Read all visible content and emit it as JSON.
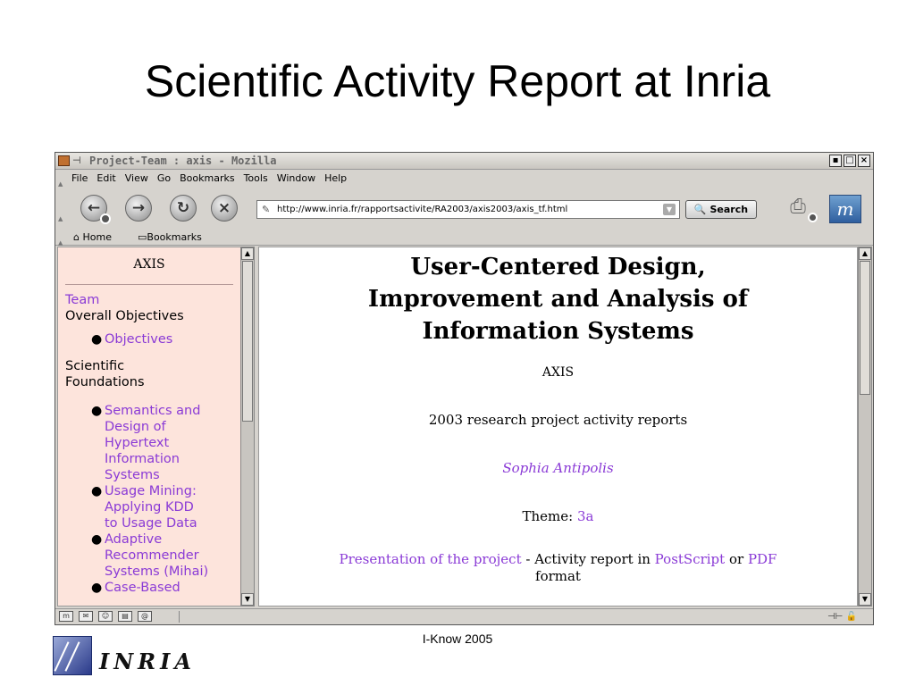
{
  "slide": {
    "title": "Scientific Activity Report at Inria",
    "footer": "I-Know 2005"
  },
  "window": {
    "title": "Project-Team : axis - Mozilla",
    "controls": [
      "▪",
      "□",
      "×"
    ]
  },
  "menubar": {
    "items": [
      "File",
      "Edit",
      "View",
      "Go",
      "Bookmarks",
      "Tools",
      "Window",
      "Help"
    ]
  },
  "navbar": {
    "url": "http://www.inria.fr/rapportsactivite/RA2003/axis2003/axis_tf.html",
    "search_label": "Search"
  },
  "bookmarks": {
    "home": "Home",
    "bookmarks": "Bookmarks"
  },
  "sidebar": {
    "heading": "AXIS",
    "team": "Team",
    "overall_objectives": "Overall Objectives",
    "objectives": "Objectives",
    "scientific_foundations_1": "Scientific",
    "scientific_foundations_2": "Foundations",
    "items": [
      [
        "Semantics and",
        "Design of",
        "Hypertext",
        "Information",
        "Systems"
      ],
      [
        "Usage Mining:",
        "Applying KDD",
        "to Usage Data"
      ],
      [
        "Adaptive",
        "Recommender",
        "Systems (Mihai)"
      ],
      [
        "Case-Based"
      ]
    ]
  },
  "content": {
    "title_line1": "User-Centered Design,",
    "title_line2": "Improvement and Analysis of",
    "title_line3": "Information Systems",
    "axis": "AXIS",
    "report": "2003 research project activity reports",
    "place": "Sophia Antipolis",
    "theme_label": "Theme: ",
    "theme_value": "3a",
    "presentation_link": "Presentation of the project",
    "activity_text": " - Activity report in ",
    "postscript_link": "PostScript",
    "or_text": " or ",
    "pdf_link": "PDF",
    "format_text": "format"
  },
  "logo": {
    "word": "INRIA"
  }
}
